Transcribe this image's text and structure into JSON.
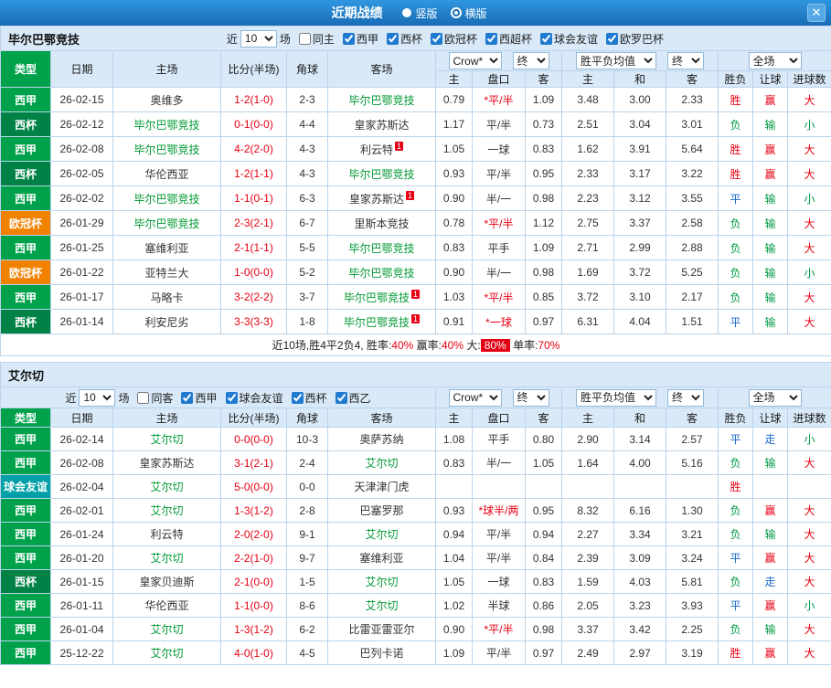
{
  "topbar": {
    "title": "近期战绩",
    "radios": [
      {
        "label": "竖版",
        "checked": false
      },
      {
        "label": "横版",
        "checked": true
      }
    ],
    "close_label": "✕"
  },
  "table_head": {
    "type": "类型",
    "date": "日期",
    "home": "主场",
    "score": "比分(半场)",
    "corner": "角球",
    "away": "客场",
    "odds_home": "主",
    "odds_handicap": "盘口",
    "odds_away": "客",
    "avg_home": "主",
    "avg_draw": "和",
    "avg_away": "客",
    "result": "胜负",
    "handicap_result": "让球",
    "goals": "进球数"
  },
  "selects": {
    "recent_prefix": "近",
    "recent_value": "10",
    "recent_suffix": "场",
    "company": "Crow*",
    "final": "终",
    "avg_label": "胜平负均值",
    "scope": "全场"
  },
  "colors": {
    "type_bg": {
      "西甲": "#00a14b",
      "西杯": "#008146",
      "欧冠杯": "#f08200",
      "球会友谊": "#00a0a6",
      "西乙": "#00a14b"
    },
    "outcome": {
      "胜": "#e60013",
      "平": "#1668c7",
      "负": "#009944",
      "赢": "#e60013",
      "走": "#1668c7",
      "输": "#009944",
      "大": "#e60013",
      "小": "#009944"
    },
    "focal_team": "#009933",
    "score": "#e60013",
    "starred_handicap": "#e60013",
    "header_bg": "#d9e9f8",
    "topbar_blue": "#1a7ad4"
  },
  "sections": [
    {
      "team": "毕尔巴鄂竞技",
      "filters": [
        {
          "label": "同主",
          "checked": false
        },
        {
          "label": "西甲",
          "checked": true
        },
        {
          "label": "西杯",
          "checked": true
        },
        {
          "label": "欧冠杯",
          "checked": true
        },
        {
          "label": "西超杯",
          "checked": true
        },
        {
          "label": "球会友谊",
          "checked": true
        },
        {
          "label": "欧罗巴杯",
          "checked": true
        }
      ],
      "rows": [
        {
          "lg": "西甲",
          "dt": "26-02-15",
          "hm": "奥维多",
          "hb": "",
          "sc": "1-2(1-0)",
          "cn": "2-3",
          "aw": "毕尔巴鄂竞技",
          "ab": "",
          "o1": "0.79",
          "hc": "*平/半",
          "o2": "1.09",
          "m1": "3.48",
          "m2": "3.00",
          "m3": "2.33",
          "rs": "胜",
          "hr": "赢",
          "ou": "大"
        },
        {
          "lg": "西杯",
          "dt": "26-02-12",
          "hm": "毕尔巴鄂竞技",
          "hb": "",
          "sc": "0-1(0-0)",
          "cn": "4-4",
          "aw": "皇家苏斯达",
          "ab": "",
          "o1": "1.17",
          "hc": "平/半",
          "o2": "0.73",
          "m1": "2.51",
          "m2": "3.04",
          "m3": "3.01",
          "rs": "负",
          "hr": "输",
          "ou": "小"
        },
        {
          "lg": "西甲",
          "dt": "26-02-08",
          "hm": "毕尔巴鄂竞技",
          "hb": "",
          "sc": "4-2(2-0)",
          "cn": "4-3",
          "aw": "利云特",
          "ab": "1",
          "o1": "1.05",
          "hc": "一球",
          "o2": "0.83",
          "m1": "1.62",
          "m2": "3.91",
          "m3": "5.64",
          "rs": "胜",
          "hr": "赢",
          "ou": "大"
        },
        {
          "lg": "西杯",
          "dt": "26-02-05",
          "hm": "华伦西亚",
          "hb": "",
          "sc": "1-2(1-1)",
          "cn": "4-3",
          "aw": "毕尔巴鄂竞技",
          "ab": "",
          "o1": "0.93",
          "hc": "平/半",
          "o2": "0.95",
          "m1": "2.33",
          "m2": "3.17",
          "m3": "3.22",
          "rs": "胜",
          "hr": "赢",
          "ou": "大"
        },
        {
          "lg": "西甲",
          "dt": "26-02-02",
          "hm": "毕尔巴鄂竞技",
          "hb": "",
          "sc": "1-1(0-1)",
          "cn": "6-3",
          "aw": "皇家苏斯达",
          "ab": "1",
          "o1": "0.90",
          "hc": "半/一",
          "o2": "0.98",
          "m1": "2.23",
          "m2": "3.12",
          "m3": "3.55",
          "rs": "平",
          "hr": "输",
          "ou": "小"
        },
        {
          "lg": "欧冠杯",
          "dt": "26-01-29",
          "hm": "毕尔巴鄂竞技",
          "hb": "",
          "sc": "2-3(2-1)",
          "cn": "6-7",
          "aw": "里斯本竞技",
          "ab": "",
          "o1": "0.78",
          "hc": "*平/半",
          "o2": "1.12",
          "m1": "2.75",
          "m2": "3.37",
          "m3": "2.58",
          "rs": "负",
          "hr": "输",
          "ou": "大"
        },
        {
          "lg": "西甲",
          "dt": "26-01-25",
          "hm": "塞维利亚",
          "hb": "",
          "sc": "2-1(1-1)",
          "cn": "5-5",
          "aw": "毕尔巴鄂竞技",
          "ab": "",
          "o1": "0.83",
          "hc": "平手",
          "o2": "1.09",
          "m1": "2.71",
          "m2": "2.99",
          "m3": "2.88",
          "rs": "负",
          "hr": "输",
          "ou": "大"
        },
        {
          "lg": "欧冠杯",
          "dt": "26-01-22",
          "hm": "亚特兰大",
          "hb": "",
          "sc": "1-0(0-0)",
          "cn": "5-2",
          "aw": "毕尔巴鄂竞技",
          "ab": "",
          "o1": "0.90",
          "hc": "半/一",
          "o2": "0.98",
          "m1": "1.69",
          "m2": "3.72",
          "m3": "5.25",
          "rs": "负",
          "hr": "输",
          "ou": "小"
        },
        {
          "lg": "西甲",
          "dt": "26-01-17",
          "hm": "马略卡",
          "hb": "",
          "sc": "3-2(2-2)",
          "cn": "3-7",
          "aw": "毕尔巴鄂竞技",
          "ab": "1",
          "o1": "1.03",
          "hc": "*平/半",
          "o2": "0.85",
          "m1": "3.72",
          "m2": "3.10",
          "m3": "2.17",
          "rs": "负",
          "hr": "输",
          "ou": "大"
        },
        {
          "lg": "西杯",
          "dt": "26-01-14",
          "hm": "利安尼劣",
          "hb": "",
          "sc": "3-3(3-3)",
          "cn": "1-8",
          "aw": "毕尔巴鄂竞技",
          "ab": "1",
          "o1": "0.91",
          "hc": "*一球",
          "o2": "0.97",
          "m1": "6.31",
          "m2": "4.04",
          "m3": "1.51",
          "rs": "平",
          "hr": "输",
          "ou": "大"
        }
      ],
      "summary": [
        {
          "t": "近10场,胜4平2负4, 胜率:",
          "s": "plain"
        },
        {
          "t": "40%",
          "s": "red"
        },
        {
          "t": " 赢率:",
          "s": "plain"
        },
        {
          "t": "40%",
          "s": "red"
        },
        {
          "t": " 大:",
          "s": "plain"
        },
        {
          "t": "80%",
          "s": "badge"
        },
        {
          "t": " 单率:",
          "s": "plain"
        },
        {
          "t": "70%",
          "s": "red"
        }
      ]
    },
    {
      "team": "艾尔切",
      "filters": [
        {
          "label": "同客",
          "checked": false
        },
        {
          "label": "西甲",
          "checked": true
        },
        {
          "label": "球会友谊",
          "checked": true
        },
        {
          "label": "西杯",
          "checked": true
        },
        {
          "label": "西乙",
          "checked": true
        }
      ],
      "rows": [
        {
          "lg": "西甲",
          "dt": "26-02-14",
          "hm": "艾尔切",
          "hb": "",
          "sc": "0-0(0-0)",
          "cn": "10-3",
          "aw": "奥萨苏纳",
          "ab": "",
          "o1": "1.08",
          "hc": "平手",
          "o2": "0.80",
          "m1": "2.90",
          "m2": "3.14",
          "m3": "2.57",
          "rs": "平",
          "hr": "走",
          "ou": "小"
        },
        {
          "lg": "西甲",
          "dt": "26-02-08",
          "hm": "皇家苏斯达",
          "hb": "",
          "sc": "3-1(2-1)",
          "cn": "2-4",
          "aw": "艾尔切",
          "ab": "",
          "o1": "0.83",
          "hc": "半/一",
          "o2": "1.05",
          "m1": "1.64",
          "m2": "4.00",
          "m3": "5.16",
          "rs": "负",
          "hr": "输",
          "ou": "大"
        },
        {
          "lg": "球会友谊",
          "dt": "26-02-04",
          "hm": "艾尔切",
          "hb": "",
          "sc": "5-0(0-0)",
          "cn": "0-0",
          "aw": "天津津门虎",
          "ab": "",
          "o1": "",
          "hc": "",
          "o2": "",
          "m1": "",
          "m2": "",
          "m3": "",
          "rs": "胜",
          "hr": "",
          "ou": ""
        },
        {
          "lg": "西甲",
          "dt": "26-02-01",
          "hm": "艾尔切",
          "hb": "",
          "sc": "1-3(1-2)",
          "cn": "2-8",
          "aw": "巴塞罗那",
          "ab": "",
          "o1": "0.93",
          "hc": "*球半/两",
          "o2": "0.95",
          "m1": "8.32",
          "m2": "6.16",
          "m3": "1.30",
          "rs": "负",
          "hr": "赢",
          "ou": "大"
        },
        {
          "lg": "西甲",
          "dt": "26-01-24",
          "hm": "利云特",
          "hb": "",
          "sc": "2-0(2-0)",
          "cn": "9-1",
          "aw": "艾尔切",
          "ab": "",
          "o1": "0.94",
          "hc": "平/半",
          "o2": "0.94",
          "m1": "2.27",
          "m2": "3.34",
          "m3": "3.21",
          "rs": "负",
          "hr": "输",
          "ou": "大"
        },
        {
          "lg": "西甲",
          "dt": "26-01-20",
          "hm": "艾尔切",
          "hb": "",
          "sc": "2-2(1-0)",
          "cn": "9-7",
          "aw": "塞维利亚",
          "ab": "",
          "o1": "1.04",
          "hc": "平/半",
          "o2": "0.84",
          "m1": "2.39",
          "m2": "3.09",
          "m3": "3.24",
          "rs": "平",
          "hr": "赢",
          "ou": "大"
        },
        {
          "lg": "西杯",
          "dt": "26-01-15",
          "hm": "皇家贝迪斯",
          "hb": "",
          "sc": "2-1(0-0)",
          "cn": "1-5",
          "aw": "艾尔切",
          "ab": "",
          "o1": "1.05",
          "hc": "一球",
          "o2": "0.83",
          "m1": "1.59",
          "m2": "4.03",
          "m3": "5.81",
          "rs": "负",
          "hr": "走",
          "ou": "大"
        },
        {
          "lg": "西甲",
          "dt": "26-01-11",
          "hm": "华伦西亚",
          "hb": "",
          "sc": "1-1(0-0)",
          "cn": "8-6",
          "aw": "艾尔切",
          "ab": "",
          "o1": "1.02",
          "hc": "半球",
          "o2": "0.86",
          "m1": "2.05",
          "m2": "3.23",
          "m3": "3.93",
          "rs": "平",
          "hr": "赢",
          "ou": "小"
        },
        {
          "lg": "西甲",
          "dt": "26-01-04",
          "hm": "艾尔切",
          "hb": "",
          "sc": "1-3(1-2)",
          "cn": "6-2",
          "aw": "比雷亚雷亚尔",
          "ab": "",
          "o1": "0.90",
          "hc": "*平/半",
          "o2": "0.98",
          "m1": "3.37",
          "m2": "3.42",
          "m3": "2.25",
          "rs": "负",
          "hr": "输",
          "ou": "大"
        },
        {
          "lg": "西甲",
          "dt": "25-12-22",
          "hm": "艾尔切",
          "hb": "",
          "sc": "4-0(1-0)",
          "cn": "4-5",
          "aw": "巴列卡诺",
          "ab": "",
          "o1": "1.09",
          "hc": "平/半",
          "o2": "0.97",
          "m1": "2.49",
          "m2": "2.97",
          "m3": "3.19",
          "rs": "胜",
          "hr": "赢",
          "ou": "大"
        }
      ]
    }
  ]
}
